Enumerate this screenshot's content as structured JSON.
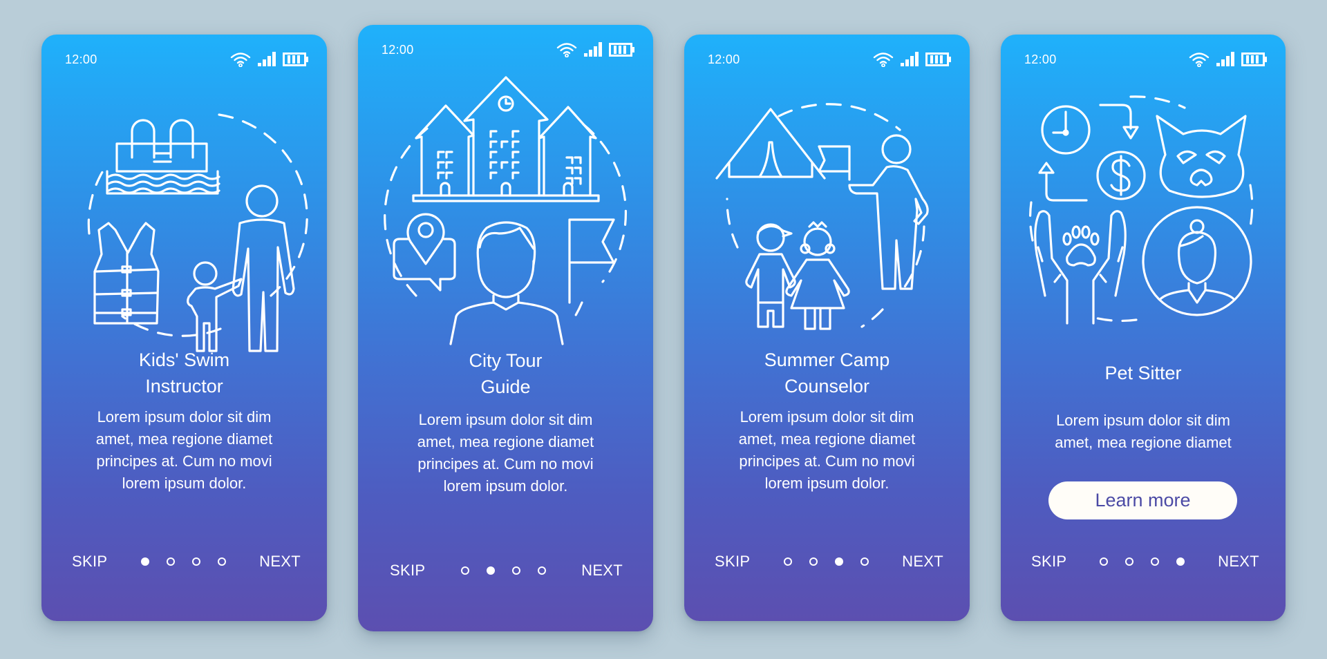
{
  "colors": {
    "background": "#b9cdd8",
    "gradient_top": "#1fb1fb",
    "gradient_bottom": "#5c4fb0",
    "button_bg": "#fffdf8",
    "button_text": "#4b4aa5"
  },
  "status_bar": {
    "time": "12:00",
    "icons": [
      "wifi-icon",
      "signal-icon",
      "battery-icon"
    ]
  },
  "screens": [
    {
      "title_line1": "Kids' Swim",
      "title_line2": "Instructor",
      "body": [
        "Lorem ipsum dolor sit dim",
        "amet, mea regione diamet",
        "principes at. Cum no movi",
        "lorem ipsum dolor."
      ],
      "illustration": "swim-instructor-illustration",
      "skip": "SKIP",
      "next": "NEXT",
      "page_index": 0,
      "page_count": 4
    },
    {
      "title_line1": "City Tour",
      "title_line2": "Guide",
      "body": [
        "Lorem ipsum dolor sit dim",
        "amet, mea regione diamet",
        "principes at. Cum no movi",
        "lorem ipsum dolor."
      ],
      "illustration": "city-tour-guide-illustration",
      "skip": "SKIP",
      "next": "NEXT",
      "page_index": 1,
      "page_count": 4
    },
    {
      "title_line1": "Summer Camp",
      "title_line2": "Counselor",
      "body": [
        "Lorem ipsum dolor sit dim",
        "amet, mea regione diamet",
        "principes at. Cum no movi",
        "lorem ipsum dolor."
      ],
      "illustration": "summer-camp-illustration",
      "skip": "SKIP",
      "next": "NEXT",
      "page_index": 2,
      "page_count": 4
    },
    {
      "title_line1": "Pet Sitter",
      "body": [
        "Lorem ipsum dolor sit dim",
        "amet, mea regione diamet"
      ],
      "button_label": "Learn more",
      "illustration": "pet-sitter-illustration",
      "skip": "SKIP",
      "next": "NEXT",
      "page_index": 3,
      "page_count": 4
    }
  ]
}
